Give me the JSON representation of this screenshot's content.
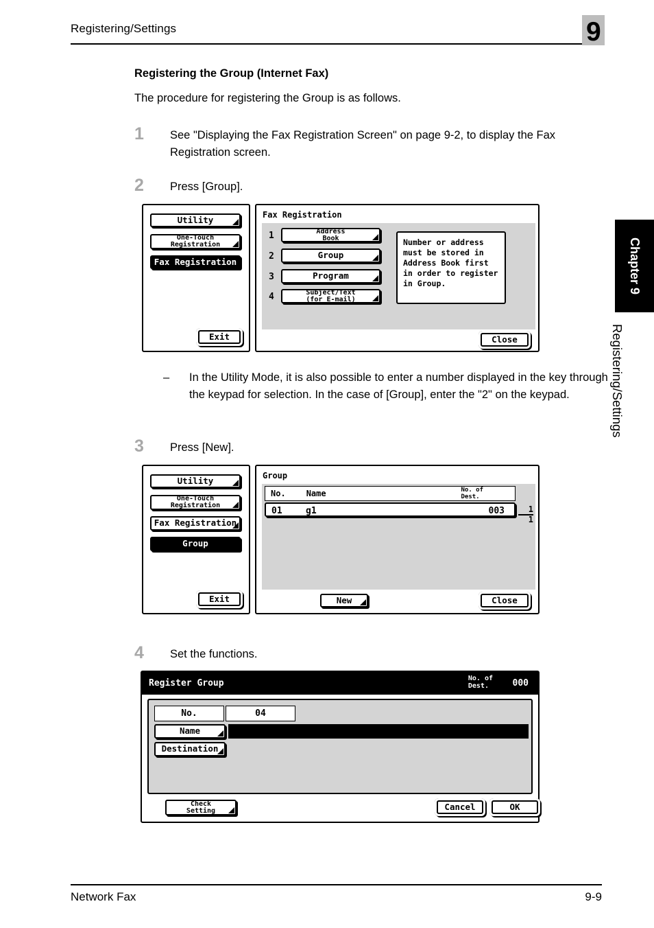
{
  "header": {
    "title": "Registering/Settings",
    "chapter_number": "9"
  },
  "side_tab": {
    "chapter_label": "Chapter 9",
    "section_label": "Registering/Settings"
  },
  "footer": {
    "left": "Network Fax",
    "page": "9-9"
  },
  "content": {
    "section_title": "Registering the Group (Internet Fax)",
    "intro": "The procedure for registering the Group is as follows.",
    "steps": [
      {
        "num": "1",
        "text": "See \"Displaying the Fax Registration Screen\" on page 9-2, to display the Fax Registration screen."
      },
      {
        "num": "2",
        "text": "Press [Group]."
      },
      {
        "num": "3",
        "text": "Press [New]."
      },
      {
        "num": "4",
        "text": "Set the functions."
      }
    ],
    "note": {
      "dash": "–",
      "text": "In the Utility Mode, it is also possible to enter a number displayed in the key through the keypad for selection. In the case of [Group], enter the \"2\" on the keypad."
    }
  },
  "screen_step2": {
    "left_menu": {
      "items": [
        "Utility",
        "One-Touch\nRegistration",
        "Fax Registration"
      ],
      "selected_index": 2,
      "exit_label": "Exit"
    },
    "right": {
      "title": "Fax Registration",
      "numbered_buttons": [
        {
          "num": "1",
          "label": "Address\nBook"
        },
        {
          "num": "2",
          "label": "Group"
        },
        {
          "num": "3",
          "label": "Program"
        },
        {
          "num": "4",
          "label": "Subject/Text\n(for E-mail)"
        }
      ],
      "message": "Number or address\nmust be stored in\nAddress Book first\nin order to register\nin Group.",
      "close_label": "Close"
    }
  },
  "screen_step3": {
    "left_menu": {
      "items": [
        "Utility",
        "One-Touch\nRegistration",
        "Fax Registration",
        "Group"
      ],
      "selected_index": 3,
      "exit_label": "Exit"
    },
    "right": {
      "title": "Group",
      "columns": {
        "no": "No.",
        "name": "Name",
        "dest": "No. of\nDest."
      },
      "rows": [
        {
          "no": "01",
          "name": "g1",
          "dest": "003"
        }
      ],
      "page_current": "1",
      "page_total": "1",
      "new_label": "New",
      "close_label": "Close"
    }
  },
  "screen_step4": {
    "title": "Register Group",
    "dest_label": "No. of\nDest.",
    "dest_value": "000",
    "fields": {
      "no_label": "No.",
      "no_value": "04",
      "name_label": "Name",
      "name_value": "",
      "destination_label": "Destination"
    },
    "buttons": {
      "check_setting": "Check\nSetting",
      "cancel": "Cancel",
      "ok": "OK"
    }
  }
}
